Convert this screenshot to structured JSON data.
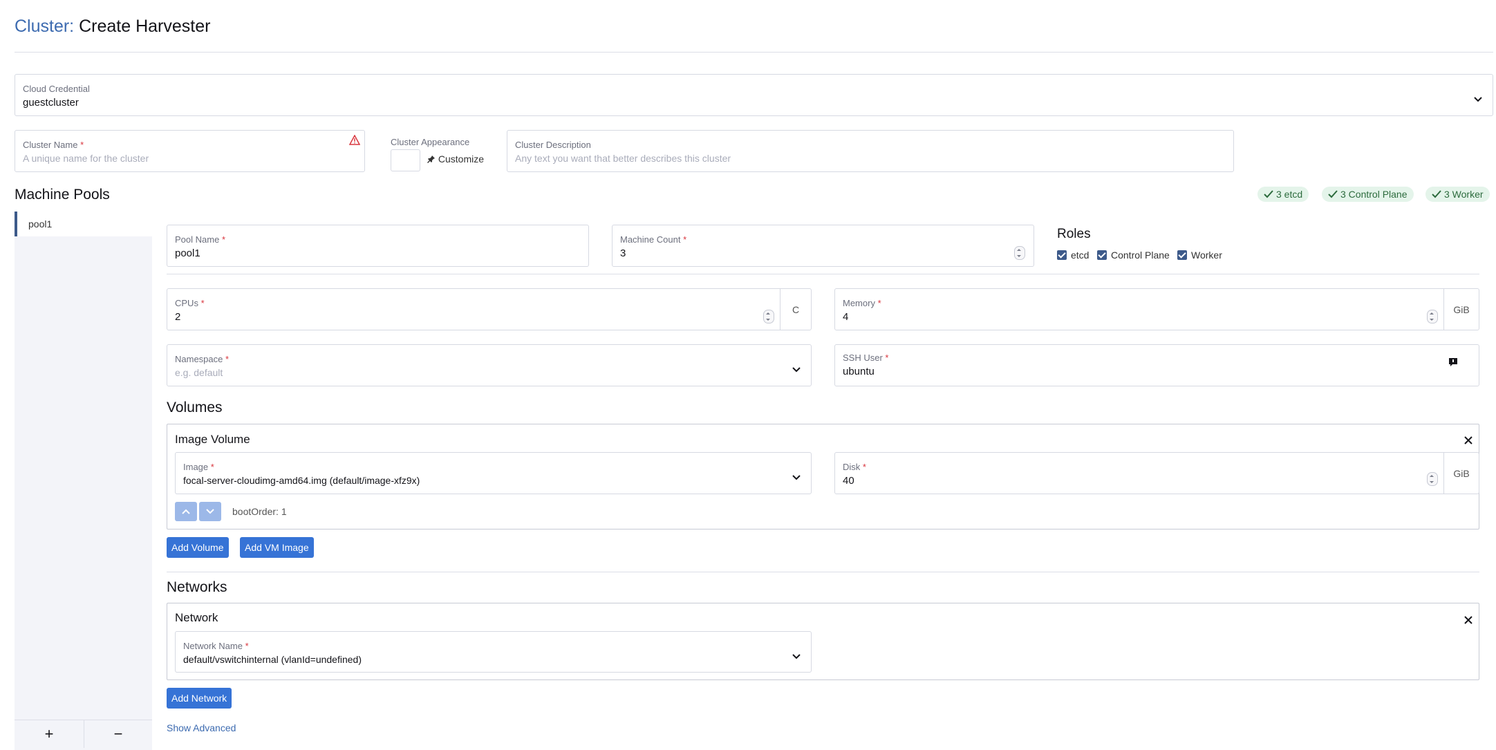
{
  "header": {
    "prefix": "Cluster:",
    "title": "Create Harvester"
  },
  "cloud_credential": {
    "label": "Cloud Credential",
    "value": "guestcluster"
  },
  "cluster_name": {
    "label": "Cluster Name",
    "placeholder": "A unique name for the cluster"
  },
  "appearance": {
    "label": "Cluster Appearance",
    "customize": "Customize"
  },
  "description": {
    "label": "Cluster Description",
    "placeholder": "Any text you want that better describes this cluster"
  },
  "machine_pools": {
    "title": "Machine Pools",
    "badges": [
      "3 etcd",
      "3 Control Plane",
      "3 Worker"
    ],
    "pools": [
      "pool1"
    ],
    "add": "+",
    "remove": "−"
  },
  "pool": {
    "pool_name": {
      "label": "Pool Name",
      "value": "pool1"
    },
    "machine_count": {
      "label": "Machine Count",
      "value": "3"
    },
    "roles": {
      "title": "Roles",
      "items": [
        "etcd",
        "Control Plane",
        "Worker"
      ]
    },
    "cpus": {
      "label": "CPUs",
      "value": "2",
      "unit": "C"
    },
    "memory": {
      "label": "Memory",
      "value": "4",
      "unit": "GiB"
    },
    "namespace": {
      "label": "Namespace",
      "placeholder": "e.g. default"
    },
    "ssh_user": {
      "label": "SSH User",
      "value": "ubuntu"
    }
  },
  "volumes": {
    "title": "Volumes",
    "card_title": "Image Volume",
    "image": {
      "label": "Image",
      "value": "focal-server-cloudimg-amd64.img (default/image-xfz9x)"
    },
    "disk": {
      "label": "Disk",
      "value": "40",
      "unit": "GiB"
    },
    "boot_order": "bootOrder: 1",
    "add_volume": "Add Volume",
    "add_vm_image": "Add VM Image"
  },
  "networks": {
    "title": "Networks",
    "card_title": "Network",
    "network_name": {
      "label": "Network Name",
      "value": "default/vswitchinternal (vlanId=undefined)"
    },
    "add_network": "Add Network",
    "show_advanced": "Show Advanced"
  },
  "colors": {
    "accent": "#3d6bb0",
    "button": "#3673d6",
    "badge_bg": "#e4f4ea",
    "badge_fg": "#2c6b3d",
    "required": "#d9363e"
  }
}
